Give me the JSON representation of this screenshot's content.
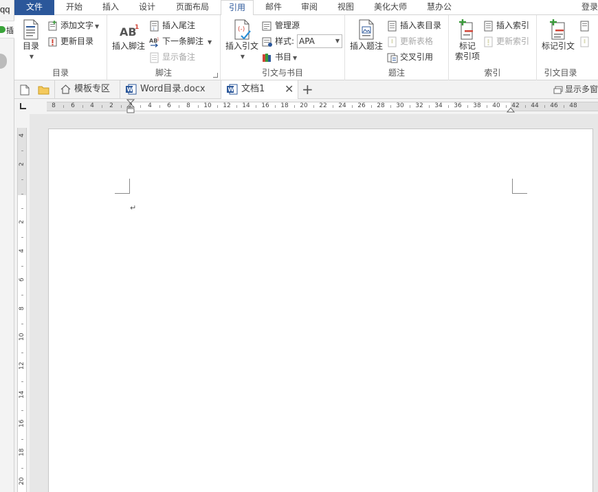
{
  "left_window": {
    "text": "qq",
    "check_text": "插"
  },
  "tabs": [
    {
      "label": "文件"
    },
    {
      "label": "开始"
    },
    {
      "label": "插入"
    },
    {
      "label": "设计"
    },
    {
      "label": "页面布局"
    },
    {
      "label": "引用"
    },
    {
      "label": "邮件"
    },
    {
      "label": "审阅"
    },
    {
      "label": "视图"
    },
    {
      "label": "美化大师"
    },
    {
      "label": "慧办公"
    }
  ],
  "login_label": "登录",
  "ribbon": {
    "toc": {
      "group_label": "目录",
      "toc_button": "目录",
      "add_text": "添加文字",
      "update_toc": "更新目录"
    },
    "footnotes": {
      "group_label": "脚注",
      "insert_footnote": "插入脚注",
      "insert_endnote": "插入尾注",
      "next_footnote": "下一条脚注",
      "show_notes": "显示备注"
    },
    "citations": {
      "group_label": "引文与书目",
      "insert_citation": "插入引文",
      "manage_sources": "管理源",
      "style_label": "样式:",
      "style_value": "APA",
      "bibliography": "书目"
    },
    "captions": {
      "group_label": "题注",
      "insert_caption": "插入题注",
      "insert_table_of_figures": "插入表目录",
      "update_table": "更新表格",
      "cross_reference": "交叉引用"
    },
    "index": {
      "group_label": "索引",
      "mark_entry_line1": "标记",
      "mark_entry_line2": "索引项",
      "insert_index": "插入索引",
      "update_index": "更新索引"
    },
    "authorities": {
      "group_label": "引文目录",
      "mark_citation": "标记引文"
    }
  },
  "doc_tabs": {
    "template_zone": "模板专区",
    "doc1": "Word目录.docx",
    "doc2": "文档1",
    "show_multi": "显示多窗"
  },
  "hruler_labels": [
    "8",
    "6",
    "4",
    "2",
    "2",
    "4",
    "6",
    "8",
    "10",
    "12",
    "14",
    "16",
    "18",
    "20",
    "22",
    "24",
    "26",
    "28",
    "30",
    "32",
    "34",
    "36",
    "38",
    "40",
    "42",
    "44",
    "46",
    "48"
  ],
  "vruler_labels": [
    "4",
    "2",
    "2",
    "4",
    "6",
    "8",
    "10",
    "12",
    "14",
    "16",
    "18",
    "20"
  ],
  "document": {
    "paragraph_mark": "↵"
  },
  "colors": {
    "accent": "#2b579a",
    "word_blue": "#2b579a",
    "red_icon": "#d04437",
    "green_icon": "#3a9a3a"
  }
}
